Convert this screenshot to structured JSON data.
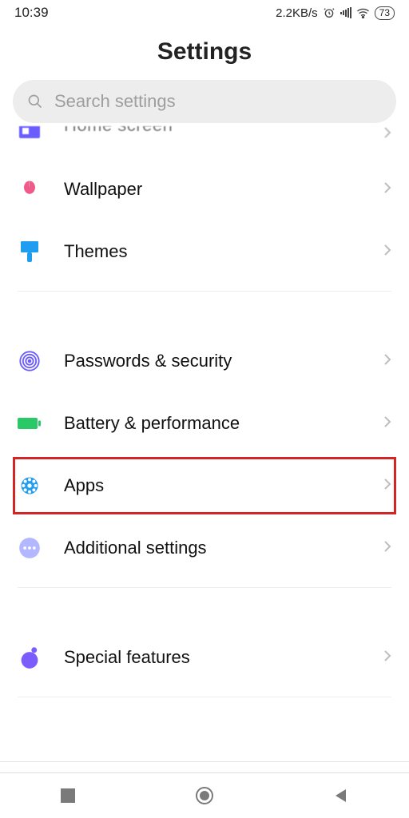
{
  "status": {
    "time": "10:39",
    "net_speed": "2.2KB/s",
    "battery": "73"
  },
  "header": {
    "title": "Settings",
    "search_placeholder": "Search settings"
  },
  "rows": {
    "home": {
      "label": "Home screen"
    },
    "wallpaper": {
      "label": "Wallpaper"
    },
    "themes": {
      "label": "Themes"
    },
    "passwords": {
      "label": "Passwords & security"
    },
    "battery": {
      "label": "Battery & performance"
    },
    "apps": {
      "label": "Apps"
    },
    "additional": {
      "label": "Additional settings"
    },
    "special": {
      "label": "Special features"
    }
  },
  "highlighted": "apps",
  "colors": {
    "highlight": "#d22626",
    "icon_purple": "#6a5cff",
    "icon_pink": "#ef5a8a",
    "icon_blue": "#1f9df1",
    "icon_green": "#29c967",
    "icon_lav": "#b2b7ff",
    "icon_violet": "#7b5cff"
  }
}
